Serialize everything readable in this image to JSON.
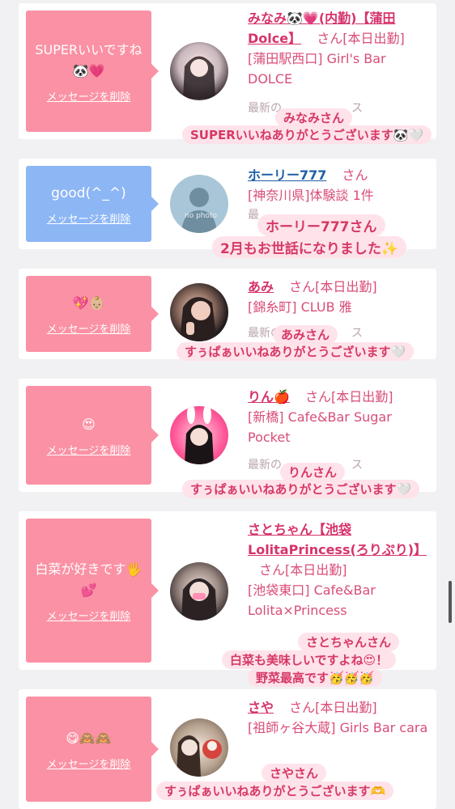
{
  "delete_label": "メッセージを削除",
  "san_label": "さん",
  "cards": [
    {
      "message": "SUPERいいですね🐼💗",
      "name": "みなみ🐼💗(内勤)【蒲田Dolce】",
      "status": "[本日出勤]",
      "shop": "[蒲田駅西口] Girl's Bar DOLCE",
      "latest": "最新の",
      "latest_tail": "ス",
      "overlay_name": "みなみさん",
      "overlay_text": "SUPERいいねありがとうございます🐼🤍"
    },
    {
      "message": "good(^_^)",
      "name": "ホーリー777",
      "status": "",
      "shop": "[神奈川県]体験談 1件",
      "latest": "最",
      "latest_tail": "",
      "overlay_name": "ホーリー777さん",
      "overlay_text": "2月もお世話になりました✨",
      "avatar_text": "no photo"
    },
    {
      "message": "💖👶🏼",
      "name": "あみ",
      "status": "[本日出勤]",
      "shop": "[錦糸町] CLUB 雅",
      "latest": "最新の",
      "latest_tail": "ス",
      "overlay_name": "あみさん",
      "overlay_text": "すぅぱぁいいねありがとうございます🤍"
    },
    {
      "message": "😍",
      "name": "りん🍎",
      "status": "[本日出勤]",
      "shop": "[新橋] Cafe&Bar Sugar Pocket",
      "latest": "最新の",
      "latest_tail": "ス",
      "overlay_name": "りんさん",
      "overlay_text": "すぅぱぁいいねありがとうございます🤍"
    },
    {
      "message": "白菜が好きです🖐💕",
      "name": "さとちゃん【池袋LolitaPrincess(ろりぷり)】",
      "status": "[本日出勤]",
      "shop": "[池袋東口] Cafe&Bar Lolita×Princess",
      "latest": "",
      "latest_tail": "",
      "overlay_name": "さとちゃんさん",
      "overlay_text": "白菜も美味しいですよね😍！",
      "overlay_text2": "野菜最高です🥳🥳🥳"
    },
    {
      "message": "😋🙈🙈",
      "name": "さや",
      "status": "[本日出勤]",
      "shop": "[祖師ヶ谷大蔵] Girls Bar cara",
      "latest": "",
      "latest_tail": "",
      "overlay_name": "さやさん",
      "overlay_text": "すぅぱぁいいねありがとうございます🫶"
    }
  ]
}
